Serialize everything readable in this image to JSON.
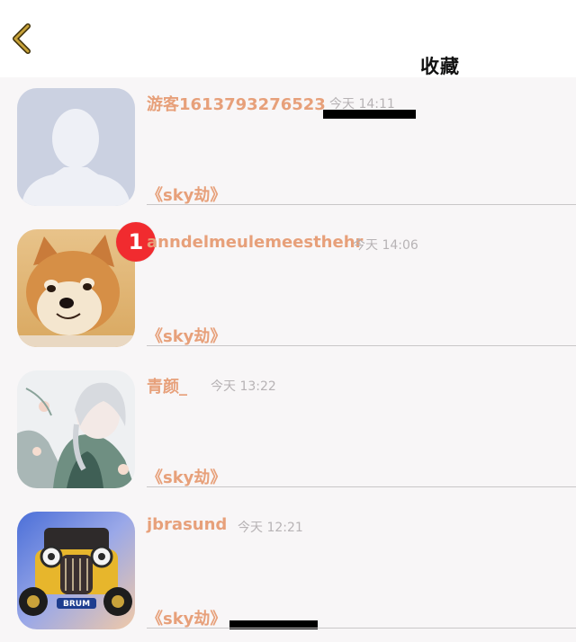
{
  "colors": {
    "accent": "#e7a07a",
    "timestamp": "#b7b3b5",
    "badge": "#f12b2f",
    "back_icon": "#b58b10",
    "background": "#f8f6f7"
  },
  "header": {
    "back_icon": "chevron-left-icon",
    "title": "收藏"
  },
  "items": [
    {
      "username": "游客1613793276523",
      "time": "今天 14:11",
      "group": "《sky劫》",
      "avatar": "default-avatar-icon",
      "badge": ""
    },
    {
      "username": "anndelmeulemeesthehr",
      "time": "今天 14:06",
      "group": "《sky劫》",
      "avatar": "shiba-dog-avatar",
      "badge": "1"
    },
    {
      "username": "青颜_",
      "time": "今天 13:22",
      "group": "《sky劫》",
      "avatar": "anime-character-avatar",
      "badge": ""
    },
    {
      "username": "jbrasund",
      "time": "今天 12:21",
      "group": "《sky劫》",
      "avatar": "brum-car-avatar",
      "badge": ""
    }
  ]
}
